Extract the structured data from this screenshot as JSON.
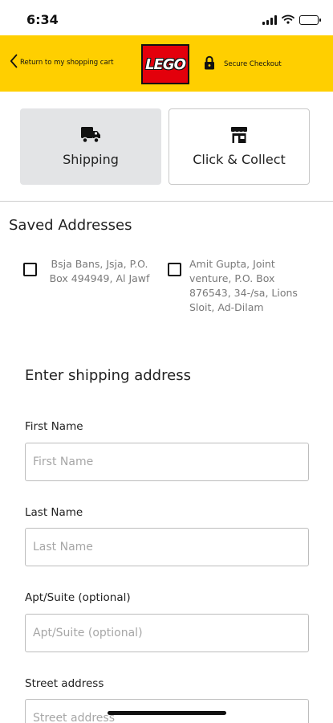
{
  "status_bar": {
    "time": "6:34",
    "icons": [
      "signal-icon",
      "wifi-icon",
      "battery-icon"
    ]
  },
  "header": {
    "back_label": "Return to my shopping cart",
    "logo_text": "LEGO",
    "secure_label": "Secure Checkout",
    "background": "#ffcf00",
    "logo_color": "#e3000b"
  },
  "delivery_methods": [
    {
      "label": "Shipping",
      "icon": "truck-icon",
      "selected": true
    },
    {
      "label": "Click & Collect",
      "icon": "store-icon",
      "selected": false
    }
  ],
  "saved_addresses": {
    "title": "Saved Addresses",
    "items": [
      {
        "text": "Bsja Bans, Jsja, P.O. Box 494949, Al Jawf",
        "checked": false
      },
      {
        "text": "Amit Gupta, Joint venture, P.O. Box 876543, 34-/sa, Lions Sloit, Ad-Dilam",
        "checked": false
      }
    ]
  },
  "shipping_form": {
    "title": "Enter shipping address",
    "fields": [
      {
        "label": "First Name",
        "placeholder": "First Name",
        "value": ""
      },
      {
        "label": "Last Name",
        "placeholder": "Last Name",
        "value": ""
      },
      {
        "label": "Apt/Suite (optional)",
        "placeholder": "Apt/Suite (optional)",
        "value": ""
      },
      {
        "label": "Street address",
        "placeholder": "Street address",
        "value": ""
      }
    ]
  }
}
